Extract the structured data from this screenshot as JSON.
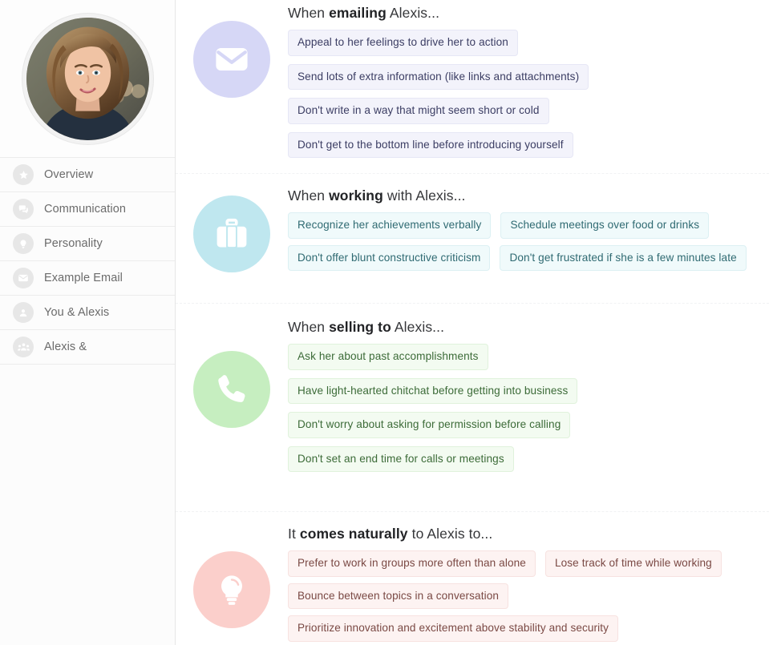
{
  "sidebar": {
    "avatar_alt": "Alexis profile photo",
    "items": [
      {
        "icon": "star-icon",
        "label": "Overview"
      },
      {
        "icon": "chat-bubbles-icon",
        "label": "Communication"
      },
      {
        "icon": "lightbulb-icon",
        "label": "Personality"
      },
      {
        "icon": "envelope-icon",
        "label": "Example Email"
      },
      {
        "icon": "person-icon",
        "label": "You & Alexis"
      },
      {
        "icon": "people-group-icon",
        "label": "Alexis &"
      }
    ]
  },
  "sections": [
    {
      "id": "emailing",
      "icon": "envelope-icon",
      "icon_circle_color": "#d6d7f6",
      "title_prefix": "When ",
      "title_bold": "emailing",
      "title_suffix": " Alexis...",
      "tags": [
        "Appeal to her feelings to drive her to action",
        "Send lots of extra information (like links and attachments)",
        "Don't write in a way that might seem short or cold",
        "Don't get to the bottom line before introducing yourself"
      ]
    },
    {
      "id": "working",
      "icon": "briefcase-icon",
      "icon_circle_color": "#bfe7ef",
      "title_prefix": "When ",
      "title_bold": "working",
      "title_suffix": " with Alexis...",
      "tags": [
        "Recognize her achievements verbally",
        "Schedule meetings over food or drinks",
        "Don't offer blunt constructive criticism",
        "Don't get frustrated if she is a few minutes late"
      ]
    },
    {
      "id": "selling",
      "icon": "phone-icon",
      "icon_circle_color": "#c6eec0",
      "title_prefix": "When ",
      "title_bold": "selling to",
      "title_suffix": " Alexis...",
      "tags": [
        "Ask her about past accomplishments",
        "Have light-hearted chitchat before getting into business",
        "Don't worry about asking for permission before calling",
        "Don't set an end time for calls or meetings"
      ]
    },
    {
      "id": "natural",
      "icon": "lightbulb-icon",
      "icon_circle_color": "#fbcfcb",
      "title_prefix": "It ",
      "title_bold": "comes naturally",
      "title_suffix": " to Alexis to...",
      "tags": [
        "Prefer to work in groups more often than alone",
        "Lose track of time while working",
        "Bounce between topics in a conversation",
        "Prioritize innovation and excitement above stability and security"
      ]
    }
  ]
}
